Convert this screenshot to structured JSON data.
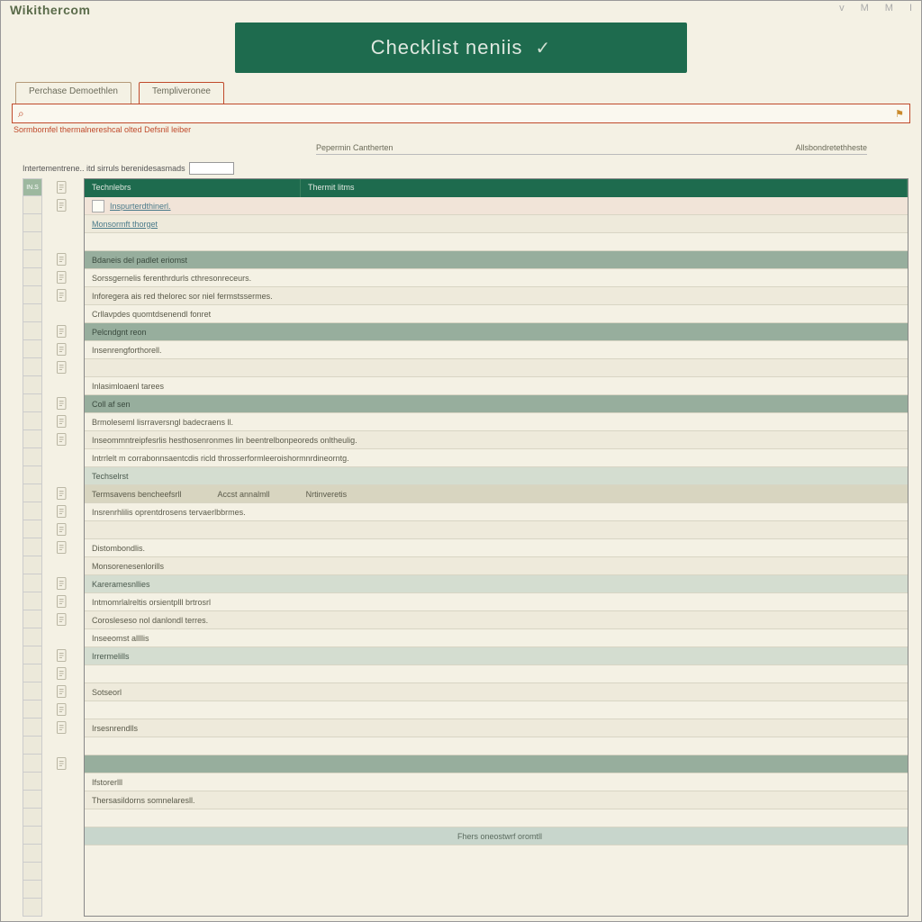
{
  "brand": "Wikithercom",
  "window_controls": [
    "v",
    "M",
    "M",
    "I"
  ],
  "banner": {
    "title": "Checklist neniis",
    "mark": "✓"
  },
  "tabs": [
    {
      "label": "Perchase Demoethlen",
      "active": false
    },
    {
      "label": "Templiveronee",
      "active": true
    }
  ],
  "search": {
    "placeholder": "",
    "icon": "search-icon",
    "right_icon": "flag-icon"
  },
  "warning": "Sormbornfel thermalnereshcal olted Defsnil leiber",
  "subheader": {
    "left": "Pepermin Cantherten",
    "right": "Allsbondretethheste"
  },
  "filter": {
    "label": "Intertementrene.. itd sirruls berenidesasmads",
    "value": ""
  },
  "columns": {
    "c1": "Technlebrs",
    "c2": "Thermit litms"
  },
  "subheader_cols": [
    "Termsavens bencheefsrll",
    "Accst annalmll",
    "Nrtinveretis"
  ],
  "gutter_rows": [
    "IN.S",
    "",
    "",
    "",
    "",
    "",
    "",
    "",
    "",
    "",
    "",
    "",
    "",
    "",
    "",
    "",
    "",
    "",
    "",
    "",
    "",
    "",
    "",
    "",
    "",
    "",
    "",
    "",
    "",
    "",
    "",
    "",
    "",
    "",
    "",
    "",
    "",
    "",
    "",
    "",
    ""
  ],
  "rows": [
    {
      "type": "item",
      "alt": false,
      "pale": true,
      "text": "Inspurterdthinerl.",
      "link": true,
      "icon": true,
      "chk": true
    },
    {
      "type": "item",
      "alt": true,
      "text": "Monsormft thorget",
      "link": true,
      "icon": true
    },
    {
      "type": "item",
      "alt": false,
      "text": "",
      "icon": false
    },
    {
      "type": "sect",
      "text": "Bdaneis del padlet eriomst"
    },
    {
      "type": "item",
      "alt": false,
      "text": "Sorssgernelis ferenthrdurls cthresonreceurs.",
      "icon": true
    },
    {
      "type": "item",
      "alt": true,
      "text": "Inforegera ais red thelorec sor niel fermstssermes.",
      "icon": true
    },
    {
      "type": "item",
      "alt": false,
      "text": "Crllavpdes quomtdsenendl fonret",
      "icon": true
    },
    {
      "type": "sect",
      "text": "Pelcndgnt reon"
    },
    {
      "type": "item",
      "alt": false,
      "text": "Insenrengforthorell.",
      "icon": true
    },
    {
      "type": "item",
      "alt": true,
      "text": "",
      "icon": true
    },
    {
      "type": "item",
      "alt": false,
      "text": "Inlasimloaenl tarees",
      "icon": true
    },
    {
      "type": "sect",
      "text": "Coll af sen"
    },
    {
      "type": "item",
      "alt": false,
      "text": "Brmoleseml lisrraversngl badecraens ll.",
      "icon": true
    },
    {
      "type": "item",
      "alt": true,
      "text": "Inseommntreipfesrlis hesthosenronmes lin beentrelbonpeoreds onltheulig.",
      "icon": true
    },
    {
      "type": "item",
      "alt": false,
      "text": "Intrrlelt m corrabonnsaentcdis ricld throsserformleeroishormnrdineorntg.",
      "icon": true
    },
    {
      "type": "sect2",
      "text": "Techselrst",
      "icon": false
    },
    {
      "type": "subh"
    },
    {
      "type": "item",
      "alt": false,
      "text": "Insrenrhlilis oprentdrosens tervaerlbbrmes.",
      "icon": true
    },
    {
      "type": "item",
      "alt": true,
      "text": "",
      "icon": true
    },
    {
      "type": "item",
      "alt": false,
      "text": "Distombondlis.",
      "icon": true
    },
    {
      "type": "item",
      "alt": true,
      "text": "Monsorenesenlorills",
      "icon": true
    },
    {
      "type": "sect2",
      "text": "Kareramesnllies"
    },
    {
      "type": "item",
      "alt": false,
      "text": "Intmomrlalreltis orsientplll brtrosrl",
      "icon": true
    },
    {
      "type": "item",
      "alt": true,
      "text": "Corosleseso nol danlondl terres.",
      "icon": true
    },
    {
      "type": "item",
      "alt": false,
      "text": "Inseeomst allllis",
      "icon": true
    },
    {
      "type": "sect2",
      "text": "Irrermelills"
    },
    {
      "type": "item",
      "alt": false,
      "text": "",
      "icon": true
    },
    {
      "type": "item",
      "alt": true,
      "text": "Sotseorl",
      "icon": true
    },
    {
      "type": "item",
      "alt": false,
      "text": "",
      "icon": true
    },
    {
      "type": "item",
      "alt": true,
      "text": "Irsesnrendlls",
      "icon": true
    },
    {
      "type": "item",
      "alt": false,
      "text": "",
      "icon": true
    },
    {
      "type": "sect",
      "text": ""
    },
    {
      "type": "item",
      "alt": false,
      "text": "Ifstorerlll",
      "icon": true
    },
    {
      "type": "item",
      "alt": true,
      "text": "Thersasildorns somnelaresll.",
      "icon": false
    },
    {
      "type": "item",
      "alt": false,
      "text": "",
      "icon": false
    },
    {
      "type": "foot",
      "text": "Fhers oneostwrf oromtll"
    }
  ]
}
